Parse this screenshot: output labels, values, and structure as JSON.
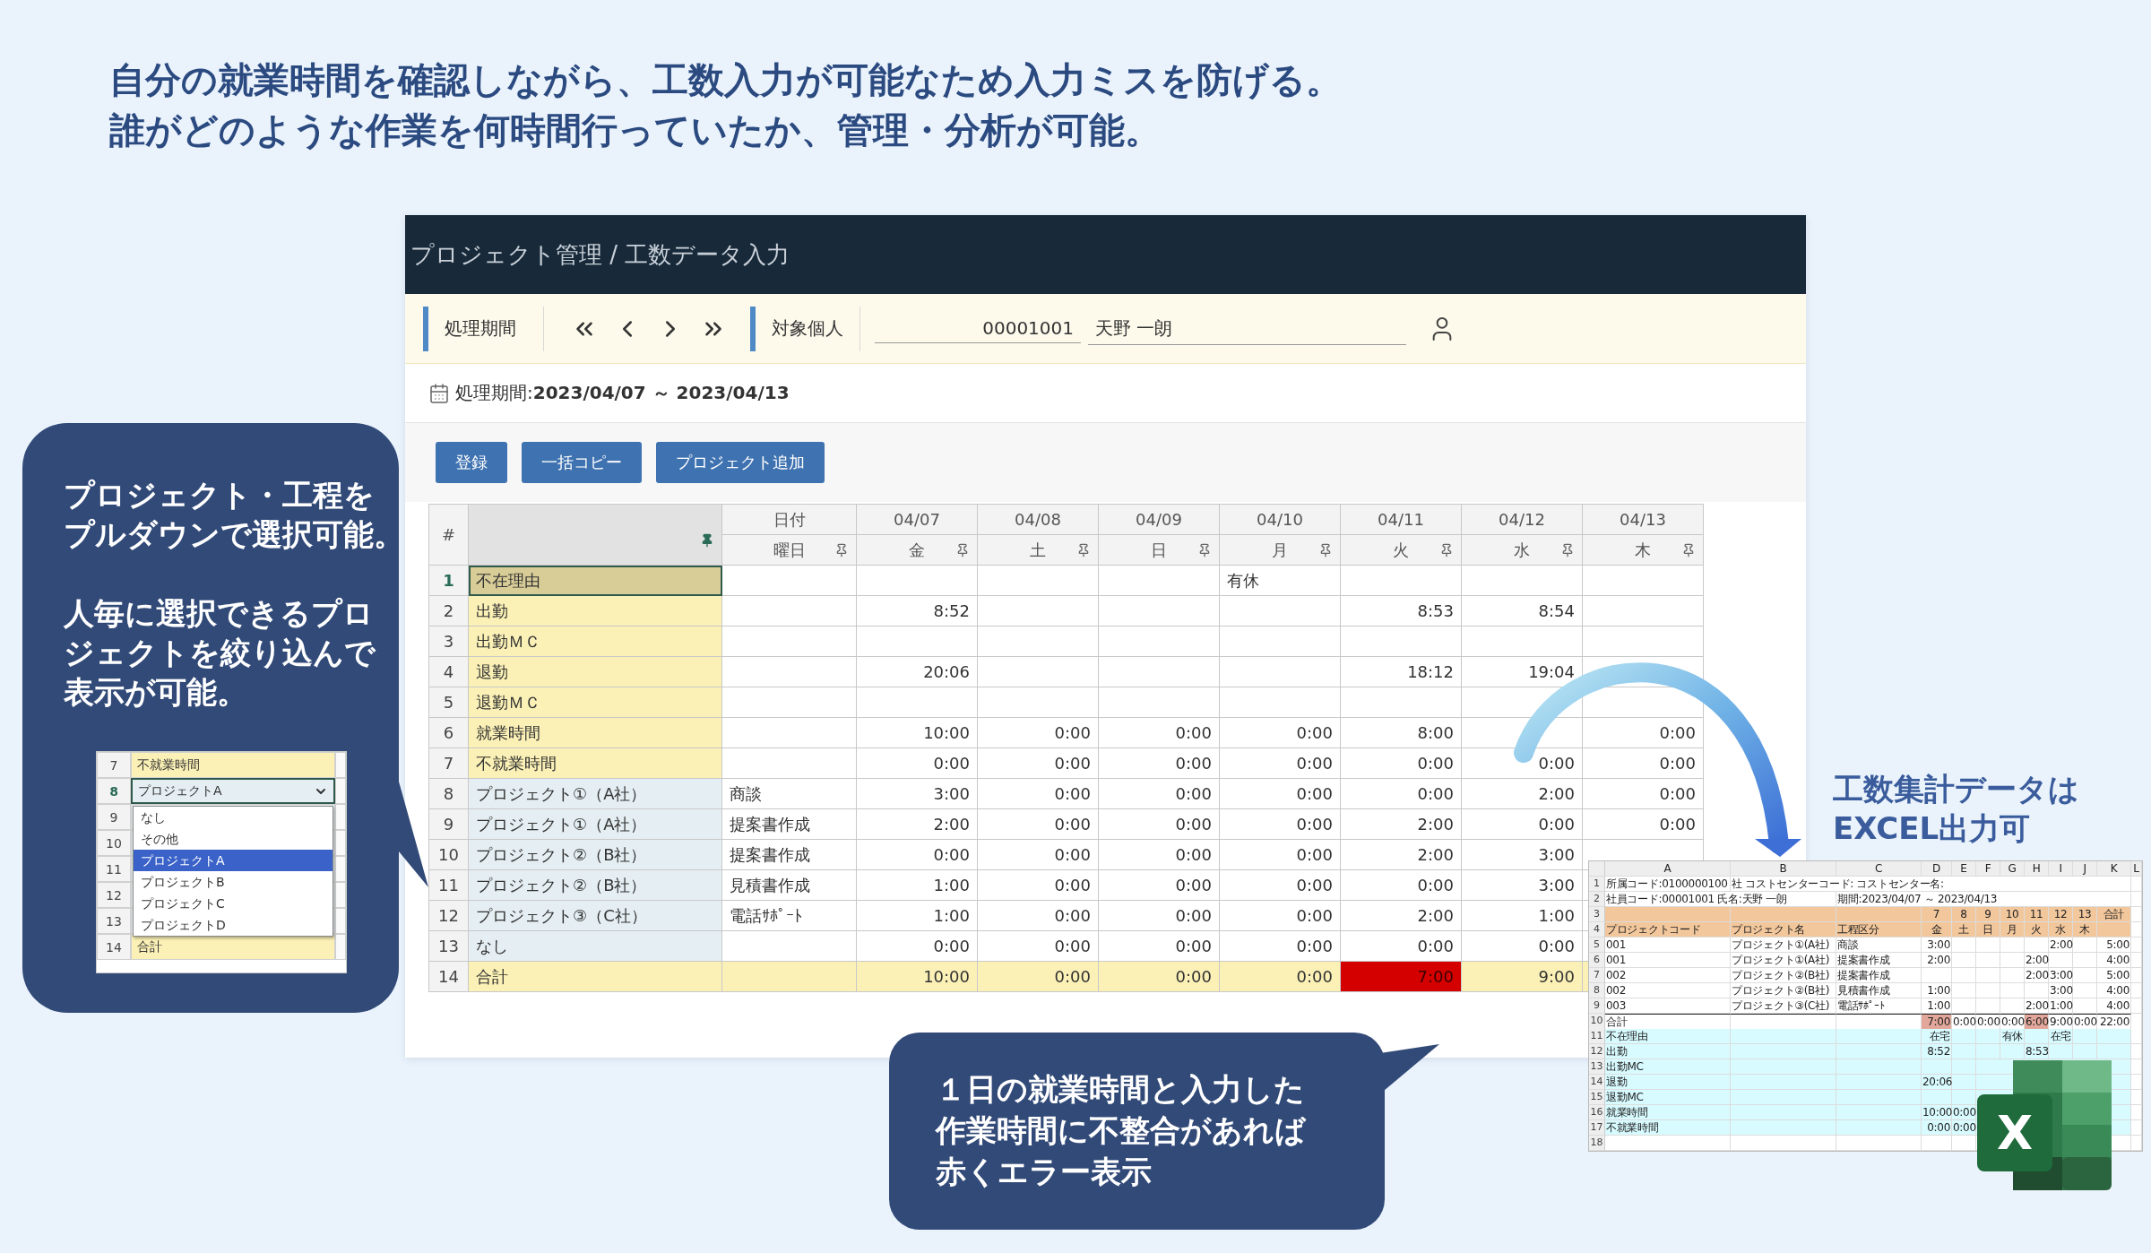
{
  "headline": [
    "自分の就業時間を確認しながら、工数入力が可能なため入力ミスを防げる。",
    "誰がどのような作業を何時間行っていたか、管理・分析が可能。"
  ],
  "app": {
    "breadcrumb": "プロジェクト管理 / 工数データ入力",
    "toolbar": {
      "period_label": "処理期間",
      "person_label": "対象個人",
      "employee_code": "00001001",
      "employee_name": "天野 一朗"
    },
    "period": "処理期間:**2023/04/07 ～ 2023/04/13**",
    "buttons": [
      "登録",
      "一括コピー",
      "プロジェクト追加"
    ],
    "table": {
      "hash_header": "#",
      "date_header": "日付",
      "weekday_header": "曜日",
      "columns": [
        {
          "date": "04/07",
          "weekday": "金"
        },
        {
          "date": "04/08",
          "weekday": "土"
        },
        {
          "date": "04/09",
          "weekday": "日"
        },
        {
          "date": "04/10",
          "weekday": "月"
        },
        {
          "date": "04/11",
          "weekday": "火"
        },
        {
          "date": "04/12",
          "weekday": "水"
        },
        {
          "date": "04/13",
          "weekday": "木"
        }
      ],
      "rows": [
        {
          "number": "1",
          "label": "不在理由",
          "kind": "reason",
          "selected": true,
          "cells": [
            {},
            {},
            {},
            {
              "text": "有休"
            },
            {},
            {},
            {}
          ]
        },
        {
          "number": "2",
          "label": "出勤",
          "kind": "attendance",
          "selected": false,
          "cells": [
            {
              "text": "8:52"
            },
            {},
            {},
            {},
            {
              "text": "8:53"
            },
            {
              "text": "8:54"
            },
            {}
          ]
        },
        {
          "number": "3",
          "label": "出勤ＭＣ",
          "kind": "attendance",
          "selected": false,
          "cells": [
            {},
            {},
            {},
            {},
            {},
            {},
            {}
          ]
        },
        {
          "number": "4",
          "label": "退勤",
          "kind": "attendance",
          "selected": false,
          "cells": [
            {
              "text": "20:06"
            },
            {},
            {},
            {},
            {
              "text": "18:12"
            },
            {
              "text": "19:04"
            },
            {}
          ]
        },
        {
          "number": "5",
          "label": "退勤ＭＣ",
          "kind": "attendance",
          "selected": false,
          "cells": [
            {},
            {},
            {},
            {},
            {},
            {},
            {}
          ]
        },
        {
          "number": "6",
          "label": "就業時間",
          "kind": "attendance",
          "selected": false,
          "cells": [
            {
              "text": "10:00"
            },
            {
              "text": "0:00"
            },
            {
              "text": "0:00"
            },
            {
              "text": "0:00"
            },
            {
              "text": "8:00"
            },
            {},
            {
              "text": "0:00"
            }
          ]
        },
        {
          "number": "7",
          "label": "不就業時間",
          "kind": "attendance",
          "selected": false,
          "cells": [
            {
              "text": "0:00"
            },
            {
              "text": "0:00"
            },
            {
              "text": "0:00"
            },
            {
              "text": "0:00"
            },
            {
              "text": "0:00"
            },
            {
              "text": "0:00"
            },
            {
              "text": "0:00"
            }
          ]
        },
        {
          "number": "8",
          "label": "プロジェクト①（A社）",
          "kind": "project",
          "selected": false,
          "process": "商談",
          "cells": [
            {
              "text": "3:00"
            },
            {
              "text": "0:00"
            },
            {
              "text": "0:00"
            },
            {
              "text": "0:00"
            },
            {
              "text": "0:00"
            },
            {
              "text": "2:00"
            },
            {
              "text": "0:00"
            }
          ]
        },
        {
          "number": "9",
          "label": "プロジェクト①（A社）",
          "kind": "project",
          "selected": false,
          "process": "提案書作成",
          "cells": [
            {
              "text": "2:00"
            },
            {
              "text": "0:00"
            },
            {
              "text": "0:00"
            },
            {
              "text": "0:00"
            },
            {
              "text": "2:00"
            },
            {
              "text": "0:00"
            },
            {
              "text": "0:00"
            }
          ]
        },
        {
          "number": "10",
          "label": "プロジェクト②（B社）",
          "kind": "project",
          "selected": false,
          "process": "提案書作成",
          "cells": [
            {
              "text": "0:00"
            },
            {
              "text": "0:00"
            },
            {
              "text": "0:00"
            },
            {
              "text": "0:00"
            },
            {
              "text": "2:00"
            },
            {
              "text": "3:00"
            },
            {}
          ]
        },
        {
          "number": "11",
          "label": "プロジェクト②（B社）",
          "kind": "project",
          "selected": false,
          "process": "見積書作成",
          "cells": [
            {
              "text": "1:00"
            },
            {
              "text": "0:00"
            },
            {
              "text": "0:00"
            },
            {
              "text": "0:00"
            },
            {
              "text": "0:00"
            },
            {
              "text": "3:00"
            },
            {}
          ]
        },
        {
          "number": "12",
          "label": "プロジェクト③（C社）",
          "kind": "project",
          "selected": false,
          "process": "電話ｻﾎﾟｰﾄ",
          "cells": [
            {
              "text": "1:00"
            },
            {
              "text": "0:00"
            },
            {
              "text": "0:00"
            },
            {
              "text": "0:00"
            },
            {
              "text": "2:00"
            },
            {
              "text": "1:00"
            },
            {}
          ]
        },
        {
          "number": "13",
          "label": "なし",
          "kind": "project",
          "selected": false,
          "cells": [
            {
              "text": "0:00"
            },
            {
              "text": "0:00"
            },
            {
              "text": "0:00"
            },
            {
              "text": "0:00"
            },
            {
              "text": "0:00"
            },
            {
              "text": "0:00"
            },
            {}
          ]
        },
        {
          "number": "14",
          "label": "合計",
          "kind": "total",
          "selected": false,
          "cells": [
            {
              "text": "10:00",
              "error": false
            },
            {
              "text": "0:00",
              "error": false
            },
            {
              "text": "0:00",
              "error": false
            },
            {
              "text": "0:00",
              "error": false
            },
            {
              "text": "7:00",
              "error": true
            },
            {
              "text": "9:00",
              "error": false
            },
            {}
          ]
        }
      ]
    }
  },
  "dropdown_callout": {
    "paragraphs": [
      [
        "プロジェクト・工程を",
        "プルダウンで選択可能。"
      ],
      [
        "人毎に選択できるプロ",
        "ジェクトを絞り込んで",
        "表示が可能。"
      ]
    ],
    "rows": [
      {
        "number": "7",
        "label": "不就業時間",
        "kind": "attendance",
        "selected": false
      },
      {
        "number": "8",
        "label": "プロジェクトA",
        "kind": "select",
        "selected": true
      },
      {
        "number": "9",
        "kind": "project",
        "selected": false
      },
      {
        "number": "10",
        "kind": "project",
        "selected": false
      },
      {
        "number": "11",
        "kind": "project",
        "selected": false
      },
      {
        "number": "12",
        "kind": "project",
        "selected": false
      },
      {
        "number": "13",
        "kind": "project",
        "selected": false
      },
      {
        "number": "14",
        "label": "合計",
        "kind": "total",
        "selected": false
      }
    ],
    "options": [
      {
        "label": "なし",
        "selected": false
      },
      {
        "label": "その他",
        "selected": false
      },
      {
        "label": "プロジェクトA",
        "selected": true
      },
      {
        "label": "プロジェクトB",
        "selected": false
      },
      {
        "label": "プロジェクトC",
        "selected": false
      },
      {
        "label": "プロジェクトD",
        "selected": false
      }
    ]
  },
  "error_callout": [
    "１日の就業時間と入力した",
    "作業時間に不整合があれば",
    "赤くエラー表示"
  ],
  "excel_caption": [
    "工数集計データは",
    "EXCEL出力可"
  ],
  "spreadsheet": {
    "columns": [
      "A",
      "B",
      "C",
      "D",
      "E",
      "F",
      "G",
      "H",
      "I",
      "J",
      "K",
      "L"
    ],
    "rows": [
      {
        "number": "1",
        "kind": "info",
        "cells": [
          {
            "text": "所属コード:0100000100"
          },
          {
            "text": "社 コストセンターコード: コストセンター名:"
          },
          {},
          {},
          {},
          {},
          {},
          {},
          {},
          {},
          {}
        ]
      },
      {
        "number": "2",
        "kind": "info",
        "cells": [
          {
            "text": "社員コード:00001001 氏名:天野 一朗"
          },
          {},
          {
            "text": "期間:2023/04/07 ～ 2023/04/13"
          },
          {},
          {},
          {},
          {},
          {},
          {},
          {},
          {}
        ]
      },
      {
        "number": "3",
        "kind": "header",
        "cells": [
          {},
          {},
          {},
          {
            "text": "7"
          },
          {
            "text": "8"
          },
          {
            "text": "9"
          },
          {
            "text": "10"
          },
          {
            "text": "11"
          },
          {
            "text": "12"
          },
          {
            "text": "13"
          },
          {
            "text": "合計"
          }
        ]
      },
      {
        "number": "4",
        "kind": "header",
        "cells": [
          {
            "text": "プロジェクトコード"
          },
          {
            "text": "プロジェクト名"
          },
          {
            "text": "工程区分"
          },
          {
            "text": "金"
          },
          {
            "text": "土"
          },
          {
            "text": "日"
          },
          {
            "text": "月"
          },
          {
            "text": "火"
          },
          {
            "text": "水"
          },
          {
            "text": "木"
          },
          {}
        ]
      },
      {
        "number": "5",
        "kind": "data",
        "cells": [
          {
            "text": "001"
          },
          {
            "text": "プロジェクト①(A社)"
          },
          {
            "text": "商談"
          },
          {
            "text": "3:00"
          },
          {},
          {},
          {},
          {},
          {
            "text": "2:00"
          },
          {},
          {
            "text": "5:00"
          }
        ]
      },
      {
        "number": "6",
        "kind": "data",
        "cells": [
          {
            "text": "001"
          },
          {
            "text": "プロジェクト①(A社)"
          },
          {
            "text": "提案書作成"
          },
          {
            "text": "2:00"
          },
          {},
          {},
          {},
          {
            "text": "2:00"
          },
          {},
          {},
          {
            "text": "4:00"
          }
        ]
      },
      {
        "number": "7",
        "kind": "data",
        "cells": [
          {
            "text": "002"
          },
          {
            "text": "プロジェクト②(B社)"
          },
          {
            "text": "提案書作成"
          },
          {},
          {},
          {},
          {},
          {
            "text": "2:00"
          },
          {
            "text": "3:00"
          },
          {},
          {
            "text": "5:00"
          }
        ]
      },
      {
        "number": "8",
        "kind": "data",
        "cells": [
          {
            "text": "002"
          },
          {
            "text": "プロジェクト②(B社)"
          },
          {
            "text": "見積書作成"
          },
          {
            "text": "1:00"
          },
          {},
          {},
          {},
          {},
          {
            "text": "3:00"
          },
          {},
          {
            "text": "4:00"
          }
        ]
      },
      {
        "number": "9",
        "kind": "data",
        "cells": [
          {
            "text": "003"
          },
          {
            "text": "プロジェクト③(C社)"
          },
          {
            "text": "電話ｻﾎﾟｰﾄ"
          },
          {
            "text": "1:00"
          },
          {},
          {},
          {},
          {
            "text": "2:00"
          },
          {
            "text": "1:00"
          },
          {},
          {
            "text": "4:00"
          }
        ]
      },
      {
        "number": "10",
        "kind": "total",
        "cells": [
          {
            "text": "合計",
            "error": false
          },
          {
            "error": false
          },
          {
            "error": false
          },
          {
            "text": "7:00",
            "error": true
          },
          {
            "text": "0:00",
            "error": false
          },
          {
            "text": "0:00",
            "error": false
          },
          {
            "text": "0:00",
            "error": false
          },
          {
            "text": "6:00",
            "error": true
          },
          {
            "text": "9:00",
            "error": false
          },
          {
            "text": "0:00",
            "error": false
          },
          {
            "text": "22:00",
            "error": false
          }
        ]
      },
      {
        "number": "11",
        "kind": "attendance",
        "cells": [
          {
            "text": "不在理由"
          },
          {},
          {},
          {
            "text": "在宅"
          },
          {},
          {},
          {
            "text": "有休"
          },
          {},
          {
            "text": "在宅"
          },
          {},
          {}
        ]
      },
      {
        "number": "12",
        "kind": "attendance",
        "cells": [
          {
            "text": "出勤"
          },
          {},
          {},
          {
            "text": "8:52"
          },
          {},
          {},
          {},
          {
            "text": "8:53"
          },
          {},
          {},
          {}
        ]
      },
      {
        "number": "13",
        "kind": "attendance",
        "cells": [
          {
            "text": "出勤MC"
          },
          {},
          {},
          {},
          {}
        ]
      },
      {
        "number": "14",
        "kind": "attendance",
        "cells": [
          {
            "text": "退勤"
          },
          {},
          {},
          {
            "text": "20:06"
          },
          {}
        ]
      },
      {
        "number": "15",
        "kind": "attendance",
        "cells": [
          {
            "text": "退勤MC"
          },
          {},
          {},
          {},
          {}
        ]
      },
      {
        "number": "16",
        "kind": "attendance",
        "cells": [
          {
            "text": "就業時間"
          },
          {},
          {},
          {
            "text": "10:00"
          },
          {
            "text": "0:00"
          }
        ]
      },
      {
        "number": "17",
        "kind": "attendance",
        "cells": [
          {
            "text": "不就業時間"
          },
          {},
          {},
          {
            "text": "0:00"
          },
          {
            "text": "0:00"
          }
        ]
      },
      {
        "number": "18",
        "kind": "blank",
        "cells": []
      }
    ]
  },
  "logo_letter": "X"
}
